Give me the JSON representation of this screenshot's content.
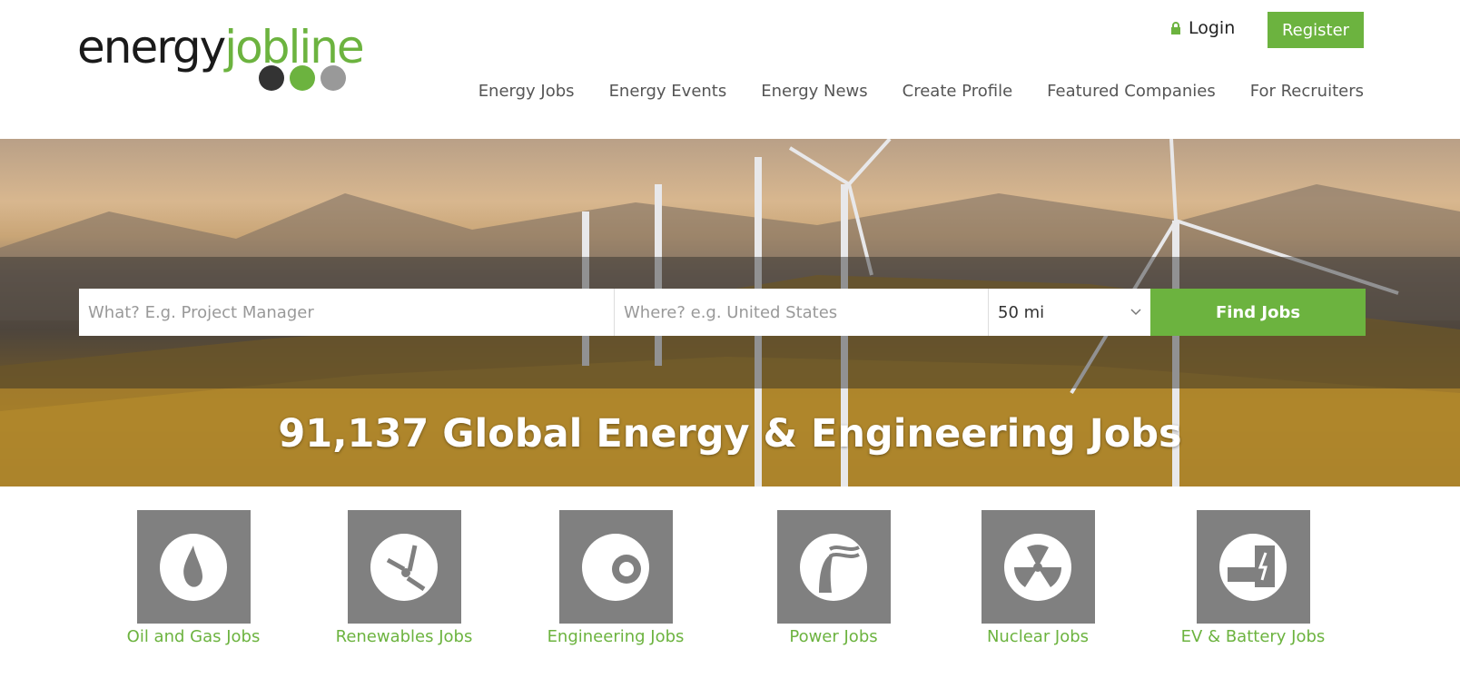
{
  "brand": {
    "logo_part1": "energy",
    "logo_part2": "jobline",
    "green": "#6cb33f"
  },
  "header": {
    "login_label": "Login",
    "register_label": "Register",
    "nav": [
      "Energy Jobs",
      "Energy Events",
      "Energy News",
      "Create Profile",
      "Featured Companies",
      "For Recruiters"
    ]
  },
  "search": {
    "what_placeholder": "What? E.g. Project Manager",
    "where_placeholder": "Where? e.g. United States",
    "radius_value": "50 mi",
    "button_label": "Find Jobs"
  },
  "hero": {
    "title": "91,137 Global Energy & Engineering Jobs"
  },
  "categories": [
    {
      "label": "Oil and Gas Jobs",
      "icon": "oil-drop-icon"
    },
    {
      "label": "Renewables Jobs",
      "icon": "wind-turbine-icon"
    },
    {
      "label": "Engineering Jobs",
      "icon": "gear-icon"
    },
    {
      "label": "Power Jobs",
      "icon": "power-plant-icon"
    },
    {
      "label": "Nuclear Jobs",
      "icon": "radiation-icon"
    },
    {
      "label": "EV & Battery Jobs",
      "icon": "ev-battery-icon"
    }
  ]
}
